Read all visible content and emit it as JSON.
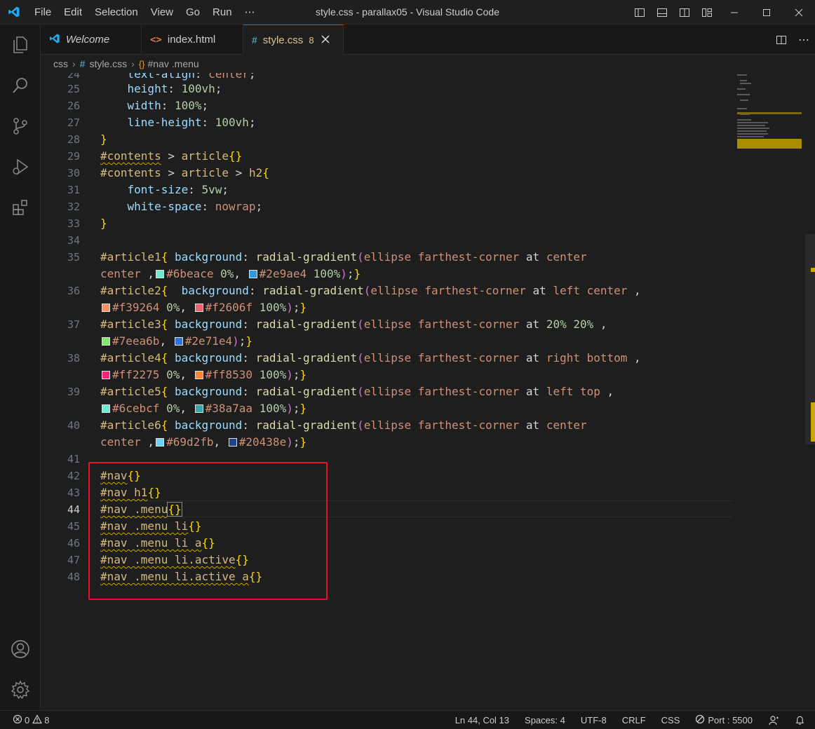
{
  "titlebar": {
    "menu": [
      "File",
      "Edit",
      "Selection",
      "View",
      "Go",
      "Run",
      "⋯"
    ],
    "title": "style.css - parallax05 - Visual Studio Code"
  },
  "tabs": [
    {
      "label": "Welcome",
      "icon": "vscode-icon"
    },
    {
      "label": "index.html",
      "icon": "html-icon"
    },
    {
      "label": "style.css",
      "icon": "css-icon",
      "badge": "8",
      "active": true
    }
  ],
  "breadcrumb": {
    "folder": "css",
    "file": "style.css",
    "symbol": "#nav .menu"
  },
  "editor": {
    "current_line": 44,
    "line_numbers": [
      "24",
      "25",
      "26",
      "27",
      "28",
      "29",
      "30",
      "31",
      "32",
      "33",
      "34",
      "35",
      "",
      "36",
      "",
      "37",
      "",
      "38",
      "",
      "39",
      "",
      "40",
      "",
      "41",
      "42",
      "43",
      "44",
      "45",
      "46",
      "47",
      "48"
    ]
  },
  "statusbar": {
    "errors": "0",
    "warnings": "8",
    "position": "Ln 44, Col 13",
    "spaces": "Spaces: 4",
    "encoding": "UTF-8",
    "eol": "CRLF",
    "language": "CSS",
    "port": "Port : 5500"
  },
  "colors": {
    "accent": "#0078d4",
    "highlight_box": "#e81123",
    "warning": "#cca700"
  }
}
